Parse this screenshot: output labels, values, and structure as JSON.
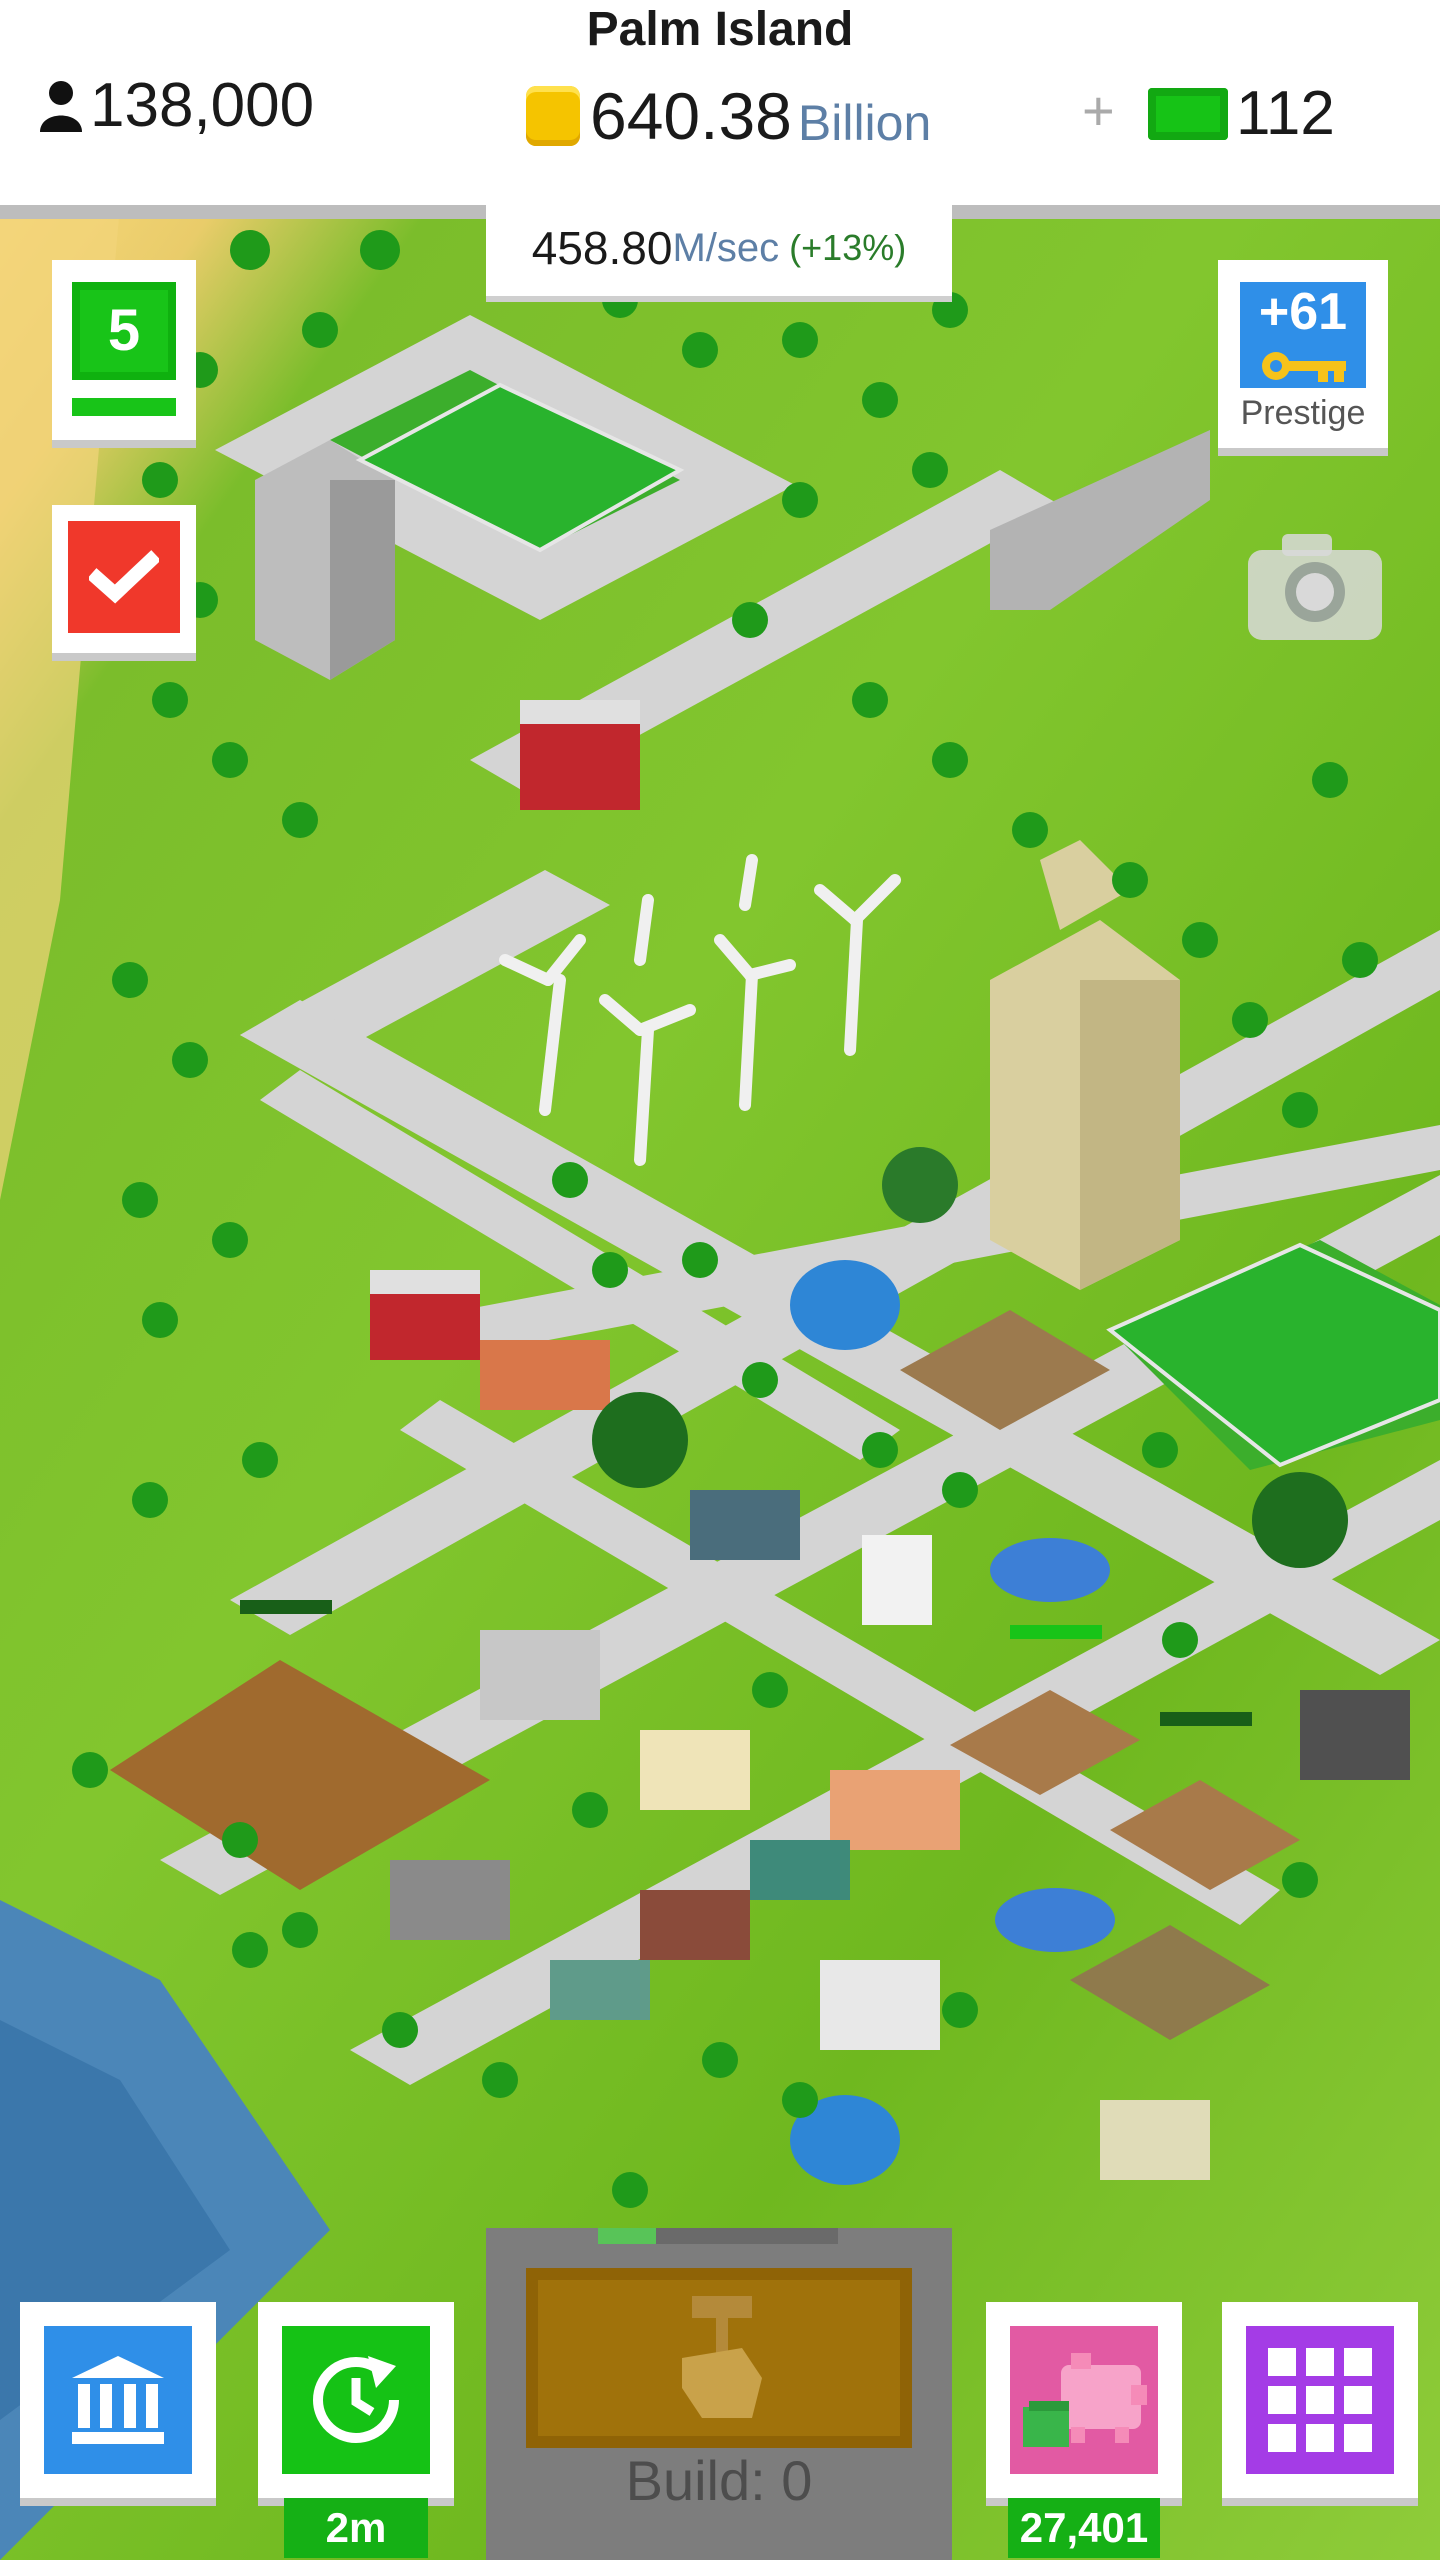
{
  "header": {
    "island_name": "Palm Island",
    "population": "138,000",
    "coins_value": "640.38",
    "coins_unit": "Billion",
    "plus_label": "+",
    "cash": "112"
  },
  "income": {
    "value": "458.80",
    "unit": "M/sec",
    "bonus": "(+13%)"
  },
  "side": {
    "level": "5",
    "prestige_value": "+61",
    "prestige_label": "Prestige"
  },
  "bottom": {
    "timer_badge": "2m",
    "build_label": "Build: 0",
    "piggy_badge": "27,401"
  },
  "colors": {
    "level_green": "#18c418",
    "task_red": "#f0382b",
    "prestige_blue": "#2f8fe8",
    "grid_purple": "#a43ce6",
    "piggy_pink": "#e25aa3",
    "grass": "#7bbd2b"
  },
  "icons": [
    "person-icon",
    "coin-icon",
    "cash-icon",
    "checkmark-icon",
    "key-icon",
    "camera-icon",
    "bank-icon",
    "clock-refresh-icon",
    "hammer-hand-icon",
    "piggy-bank-icon",
    "grid-menu-icon"
  ]
}
